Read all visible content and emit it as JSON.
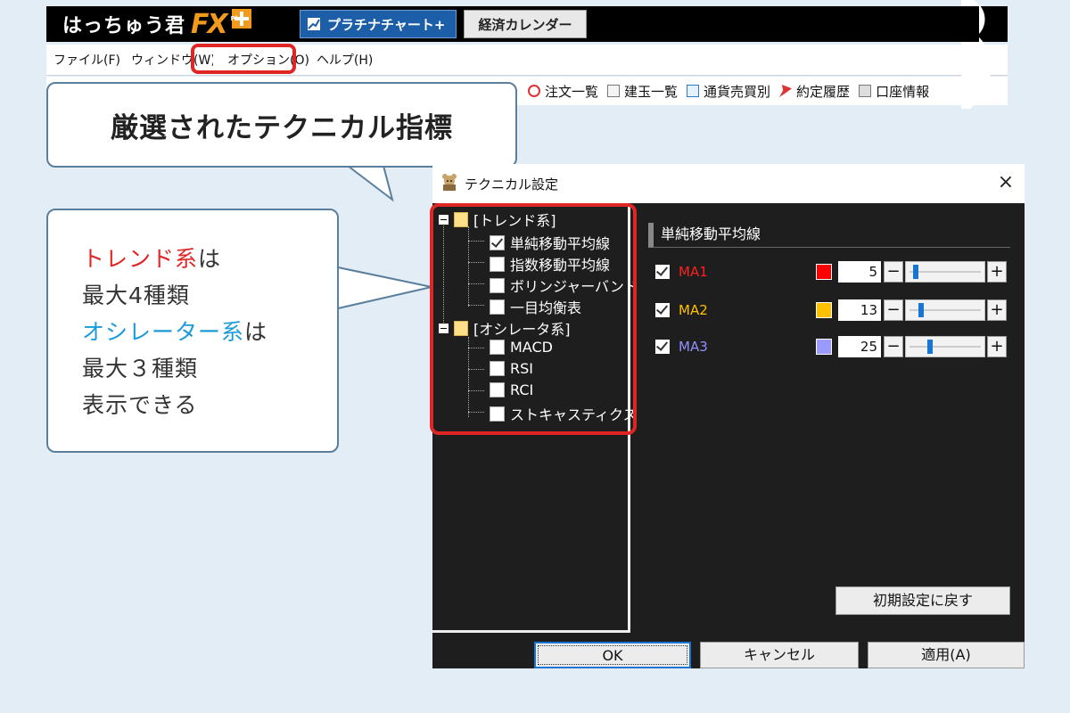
{
  "app": {
    "logo_text": "はっちゅう君",
    "logo_fx": "FX",
    "logo_plus": "Plus",
    "platinum_button": "プラチナチャート+",
    "calendar_button": "経済カレンダー",
    "menu": [
      "ファイル(F)",
      "ウィンドウ(W)",
      "オプション(O)",
      "ヘルプ(H)"
    ],
    "toolbar": [
      {
        "icon": "order-icon",
        "label": "注文一覧"
      },
      {
        "icon": "position-icon",
        "label": "建玉一覧"
      },
      {
        "icon": "currency-icon",
        "label": "通貨売買別"
      },
      {
        "icon": "pin-icon",
        "label": "約定履歴"
      },
      {
        "icon": "account-icon",
        "label": "口座情報"
      }
    ]
  },
  "callouts": {
    "title": "厳選されたテクニカル指標",
    "desc": {
      "trend": "トレンド系",
      "wa1": "は",
      "line2": "最大4種類",
      "osc": "オシレーター系",
      "wa2": "は",
      "line4": "最大３種類",
      "line5": "表示できる"
    }
  },
  "dialog": {
    "title": "テクニカル設定",
    "tree": {
      "trend_group": "[トレンド系]",
      "trend_items": [
        {
          "label": "単純移動平均線",
          "checked": true
        },
        {
          "label": "指数移動平均線",
          "checked": false
        },
        {
          "label": "ボリンジャーバンド",
          "checked": false
        },
        {
          "label": "一目均衡表",
          "checked": false
        }
      ],
      "osc_group": "[オシレータ系]",
      "osc_items": [
        {
          "label": "MACD",
          "checked": false
        },
        {
          "label": "RSI",
          "checked": false
        },
        {
          "label": "RCI",
          "checked": false
        },
        {
          "label": "ストキャスティクス",
          "checked": false
        }
      ]
    },
    "panel_title": "単純移動平均線",
    "ma_rows": [
      {
        "label": "MA1",
        "value": "5",
        "color": "#ff0000",
        "label_color": "#ff2020",
        "slider": 0.05
      },
      {
        "label": "MA2",
        "value": "13",
        "color": "#ffc000",
        "label_color": "#ffc000",
        "slider": 0.13
      },
      {
        "label": "MA3",
        "value": "25",
        "color": "#9a9aff",
        "label_color": "#8f8fff",
        "slider": 0.25
      }
    ],
    "minus": "−",
    "plus": "+",
    "reset_button": "初期設定に戻す",
    "ok_button": "OK",
    "cancel_button": "キャンセル",
    "apply_button": "適用(A)",
    "close": "×"
  },
  "colors": {
    "highlight": "#e02525",
    "accent_blue": "#1b9bd7",
    "background": "#e3edf6"
  }
}
